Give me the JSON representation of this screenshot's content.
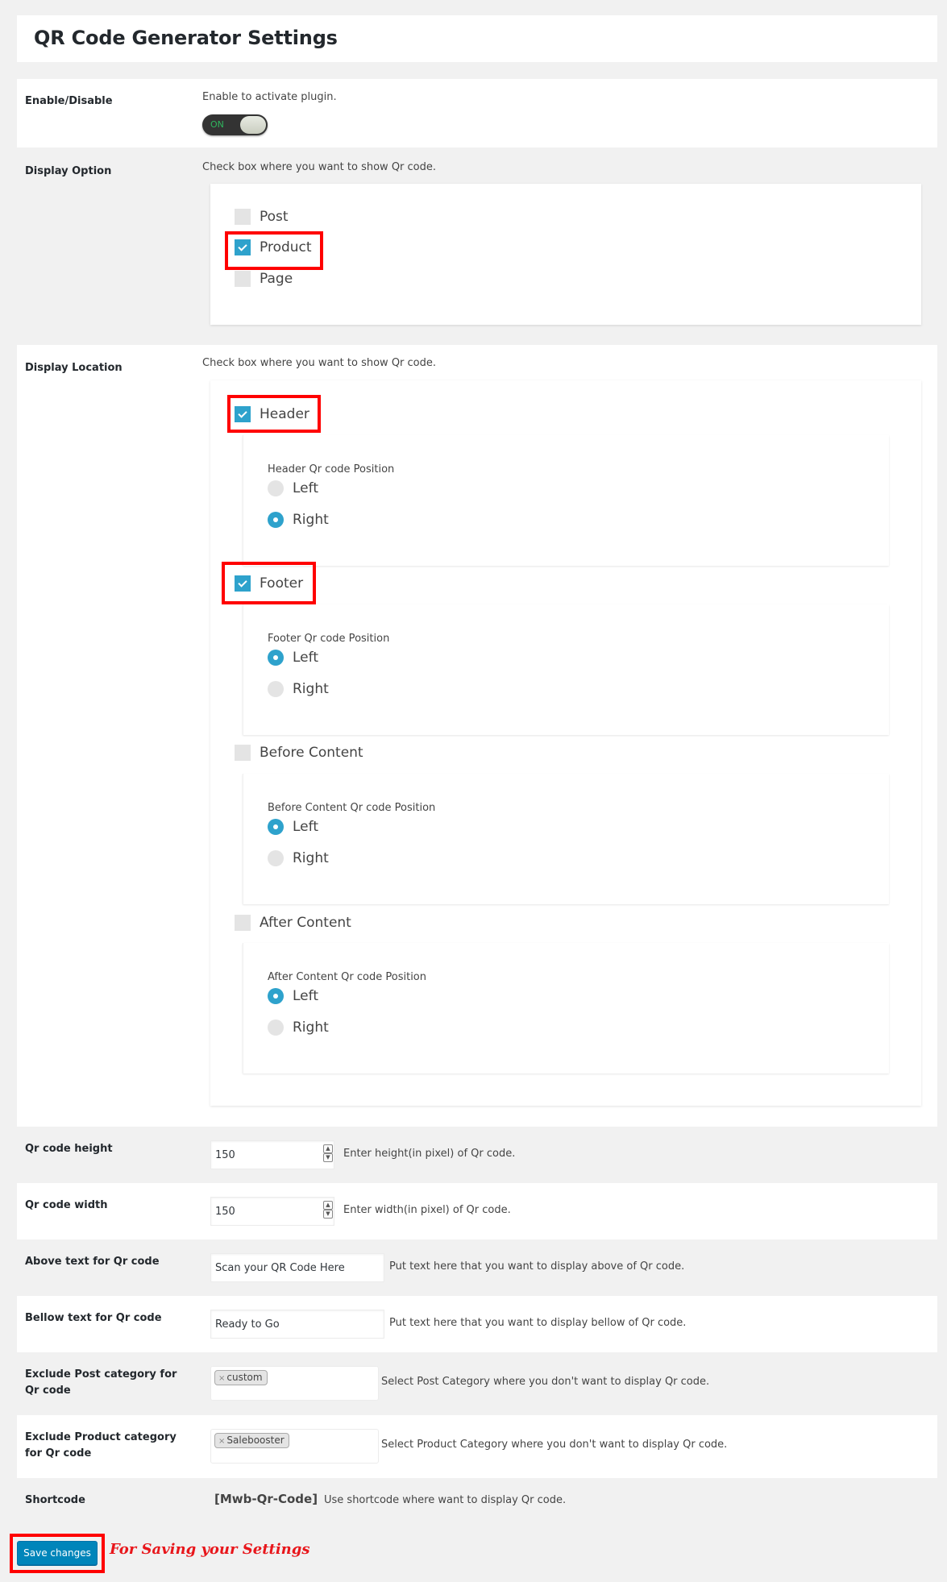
{
  "title": "QR Code Generator Settings",
  "enable": {
    "label": "Enable/Disable",
    "description": "Enable to activate plugin.",
    "toggle_text": "ON",
    "toggle_state": true
  },
  "display_option": {
    "label": "Display Option",
    "description": "Check box where you want to show Qr code.",
    "items": [
      {
        "label": "Post",
        "checked": false
      },
      {
        "label": "Product",
        "checked": true
      },
      {
        "label": "Page",
        "checked": false
      }
    ]
  },
  "display_location": {
    "label": "Display Location",
    "description": "Check box where you want to show Qr code.",
    "items": [
      {
        "label": "Header",
        "checked": true,
        "position_label": "Header Qr code Position",
        "options": [
          "Left",
          "Right"
        ],
        "selected": "Right"
      },
      {
        "label": "Footer",
        "checked": true,
        "position_label": "Footer Qr code Position",
        "options": [
          "Left",
          "Right"
        ],
        "selected": "Left"
      },
      {
        "label": "Before Content",
        "checked": false,
        "position_label": "Before Content Qr code Position",
        "options": [
          "Left",
          "Right"
        ],
        "selected": "Left"
      },
      {
        "label": "After Content",
        "checked": false,
        "position_label": "After Content Qr code Position",
        "options": [
          "Left",
          "Right"
        ],
        "selected": "Left"
      }
    ]
  },
  "qr_height": {
    "label": "Qr code height",
    "value": "150",
    "description": "Enter height(in pixel) of Qr code."
  },
  "qr_width": {
    "label": "Qr code width",
    "value": "150",
    "description": "Enter width(in pixel) of Qr code."
  },
  "above_text": {
    "label": "Above text for Qr code",
    "value": "Scan your QR Code Here",
    "description": "Put text here that you want to display above of Qr code."
  },
  "bellow_text": {
    "label": "Bellow text for Qr code",
    "value": "Ready to Go",
    "description": "Put text here that you want to display bellow of Qr code."
  },
  "exclude_post": {
    "label": "Exclude Post category for Qr code",
    "chip": "custom",
    "chip_remove": "×",
    "description": "Select Post Category where you don't want to display Qr code."
  },
  "exclude_product": {
    "label": "Exclude Product category for Qr code",
    "chip": "Salebooster",
    "chip_remove": "×",
    "description": "Select Product Category where you don't want to display Qr code."
  },
  "shortcode": {
    "label": "Shortcode",
    "code": "[Mwb-Qr-Code]",
    "description": "Use shortcode where want to display Qr code."
  },
  "save_button": "Save changes",
  "annotation": "For Saving your Settings",
  "colors": {
    "accent": "#2ea2cc",
    "button": "#0085ba",
    "highlight": "#ff0000",
    "toggle_on": "#2fb55d"
  }
}
